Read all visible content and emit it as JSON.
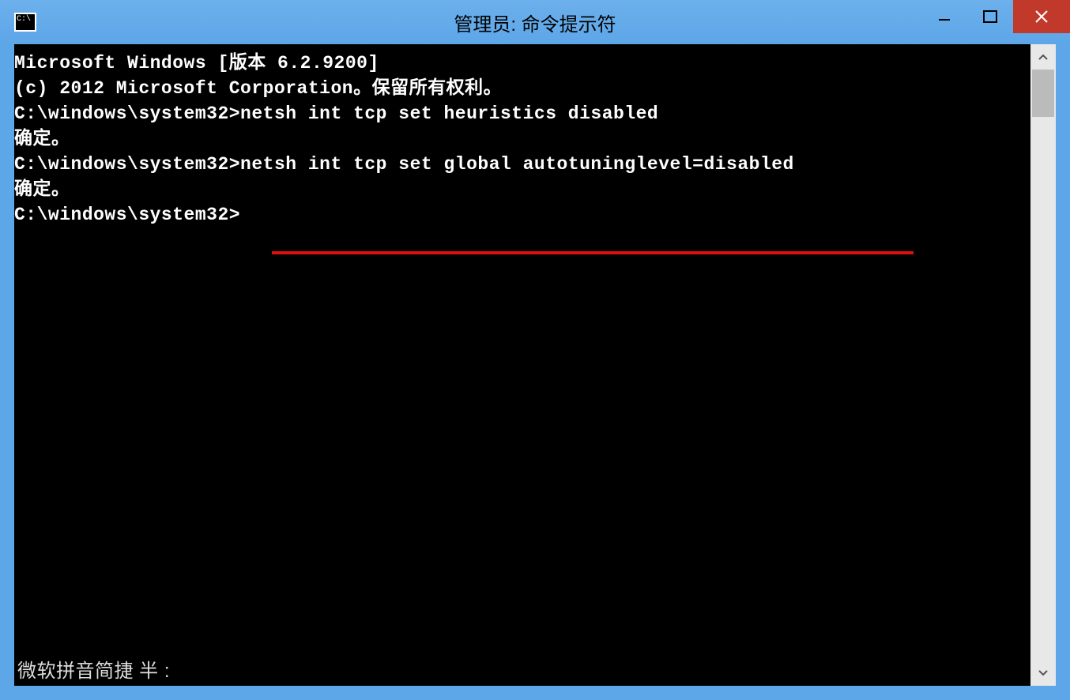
{
  "window": {
    "title": "管理员: 命令提示符"
  },
  "terminal": {
    "lines": {
      "l0": "Microsoft Windows [版本 6.2.9200]",
      "l1": "(c) 2012 Microsoft Corporation。保留所有权利。",
      "l2": "",
      "l3_prompt": "C:\\windows\\system32>",
      "l3_cmd": "netsh int tcp set heuristics disabled",
      "l4": "确定。",
      "l5": "",
      "l6": "",
      "l7_prompt": "C:\\windows\\system32>",
      "l7_cmd": "netsh int tcp set global autotuninglevel=disabled",
      "l8": "确定。",
      "l9": "",
      "l10": "",
      "l11_prompt": "C:\\windows\\system32>"
    },
    "ime": "微软拼音简捷 半 :"
  }
}
